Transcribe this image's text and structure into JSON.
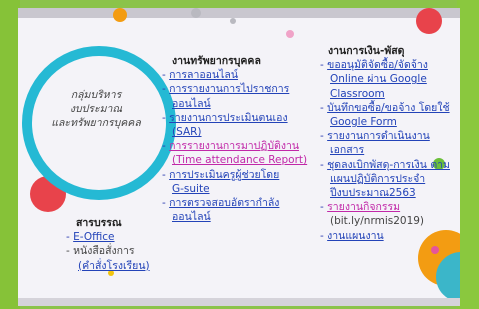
{
  "circle": {
    "line1": "กลุ่มบริหาร",
    "line2": "งบประมาณ",
    "line3": "และทรัพยากรบุคคล"
  },
  "saraban": {
    "title": "สารบรรณ",
    "eoffice": "E-Office",
    "bullet": "-",
    "line1": "หนังสือสั่งการ",
    "line2": "(คำสั่งโรงเรียน)"
  },
  "hr": {
    "title": "งานทรัพยากรบุคคล",
    "items": [
      "การลาออนไลน์",
      "การรายงานการไปราชการ",
      "ออนไลน์",
      "รายงานการประเมินตนเอง",
      "(SAR)",
      "การรายงานการมาปฏิบัติงาน",
      "(Time attendance Report)",
      "การประเมินครูผู้ช่วยโดย",
      "G-suite",
      "การตรวจสอบอัตรากำลัง",
      "ออนไลน์"
    ]
  },
  "finance": {
    "title": "งานการเงิน-พัสดุ",
    "items": [
      "ขออนุมัติจัดซื้อ/จัดจ้าง",
      "Online ผ่าน Google",
      "Classroom",
      "บันทึกขอซื้อ/ขอจ้าง โดยใช้",
      "Google Form",
      "รายงานการดำเนินงาน",
      "เอกสาร",
      "ชุดลงเบิกพัสดุ-การเงิน ตาม",
      "แผนปฏิบัติการประจำ",
      "ปีงบประมาณ2563",
      "รายงานกิจกรรม",
      "(bit.ly/nrmis2019)",
      "งานแผนงาน"
    ]
  },
  "colors": {
    "ring": "#25b9d4",
    "link": "#2343b8",
    "link_highlight": "#c128a8",
    "frame": "#8bc34a"
  }
}
